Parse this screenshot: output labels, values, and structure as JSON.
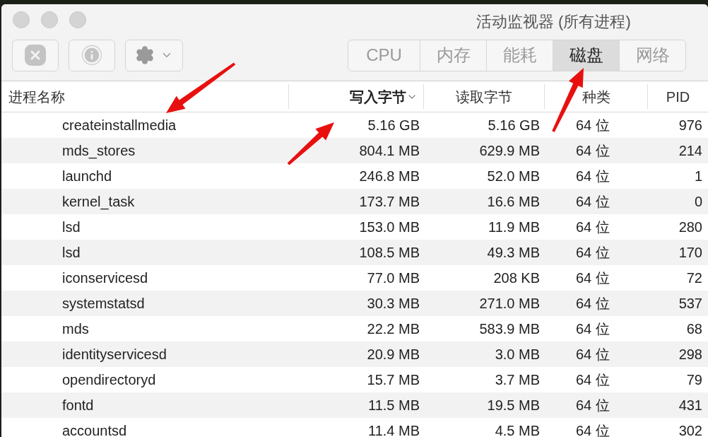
{
  "window": {
    "title": "活动监视器 (所有进程)"
  },
  "tabs": [
    {
      "label": "CPU",
      "selected": false
    },
    {
      "label": "内存",
      "selected": false
    },
    {
      "label": "能耗",
      "selected": false
    },
    {
      "label": "磁盘",
      "selected": true
    },
    {
      "label": "网络",
      "selected": false
    }
  ],
  "table": {
    "columns": [
      {
        "label": "进程名称",
        "sorted": false
      },
      {
        "label": "写入字节",
        "sorted": true
      },
      {
        "label": "读取字节",
        "sorted": false
      },
      {
        "label": "种类",
        "sorted": false
      },
      {
        "label": "PID",
        "sorted": false
      }
    ],
    "rows": [
      [
        "createinstallmedia",
        "5.16 GB",
        "5.16 GB",
        "64 位",
        "976"
      ],
      [
        "mds_stores",
        "804.1 MB",
        "629.9 MB",
        "64 位",
        "214"
      ],
      [
        "launchd",
        "246.8 MB",
        "52.0 MB",
        "64 位",
        "1"
      ],
      [
        "kernel_task",
        "173.7 MB",
        "16.6 MB",
        "64 位",
        "0"
      ],
      [
        "lsd",
        "153.0 MB",
        "11.9 MB",
        "64 位",
        "280"
      ],
      [
        "lsd",
        "108.5 MB",
        "49.3 MB",
        "64 位",
        "170"
      ],
      [
        "iconservicesd",
        "77.0 MB",
        "208 KB",
        "64 位",
        "72"
      ],
      [
        "systemstatsd",
        "30.3 MB",
        "271.0 MB",
        "64 位",
        "537"
      ],
      [
        "mds",
        "22.2 MB",
        "583.9 MB",
        "64 位",
        "68"
      ],
      [
        "identityservicesd",
        "20.9 MB",
        "3.0 MB",
        "64 位",
        "298"
      ],
      [
        "opendirectoryd",
        "15.7 MB",
        "3.7 MB",
        "64 位",
        "79"
      ],
      [
        "fontd",
        "11.5 MB",
        "19.5 MB",
        "64 位",
        "431"
      ],
      [
        "accountsd",
        "11.4 MB",
        "4.5 MB",
        "64 位",
        "302"
      ]
    ]
  }
}
